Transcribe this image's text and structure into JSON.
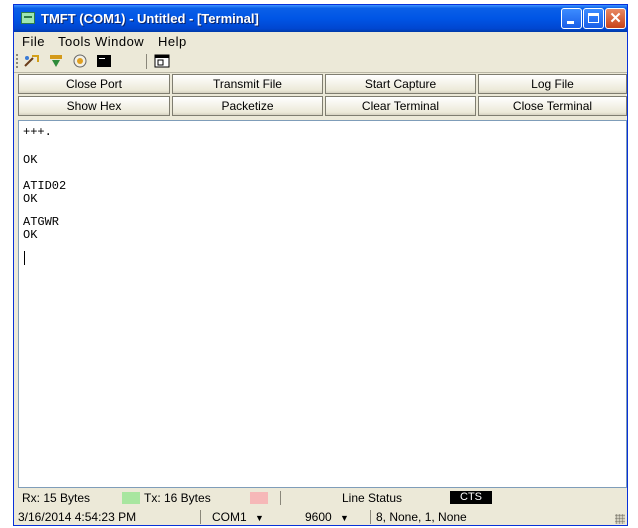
{
  "window": {
    "title": "TMFT (COM1) - Untitled - [Terminal]"
  },
  "menu": [
    "File",
    "Tools Window",
    "Help"
  ],
  "toolbar_icons": [
    "connect-icon",
    "transmit-icon",
    "capture-icon",
    "terminal-icon",
    "window-icon"
  ],
  "buttons": {
    "row1": [
      "Close Port",
      "Transmit File",
      "Start Capture",
      "Log File"
    ],
    "row2": [
      "Show Hex",
      "Packetize",
      "Clear Terminal",
      "Close Terminal"
    ]
  },
  "terminal": {
    "lines": [
      "+++.",
      "OK",
      "ATID02",
      "OK",
      "ATGWR",
      "OK"
    ]
  },
  "status": {
    "rx": "Rx: 15 Bytes",
    "tx": "Tx: 16 Bytes",
    "line_status_label": "Line Status",
    "cts": "CTS",
    "timestamp": "3/16/2014 4:54:23 PM",
    "port": "COM1",
    "baud": "9600",
    "settings": "8, None, 1, None"
  },
  "colors": {
    "rx_indicator": "#a8e6a0",
    "tx_indicator": "#f6b8b8",
    "titlebar": "#0055e5"
  }
}
